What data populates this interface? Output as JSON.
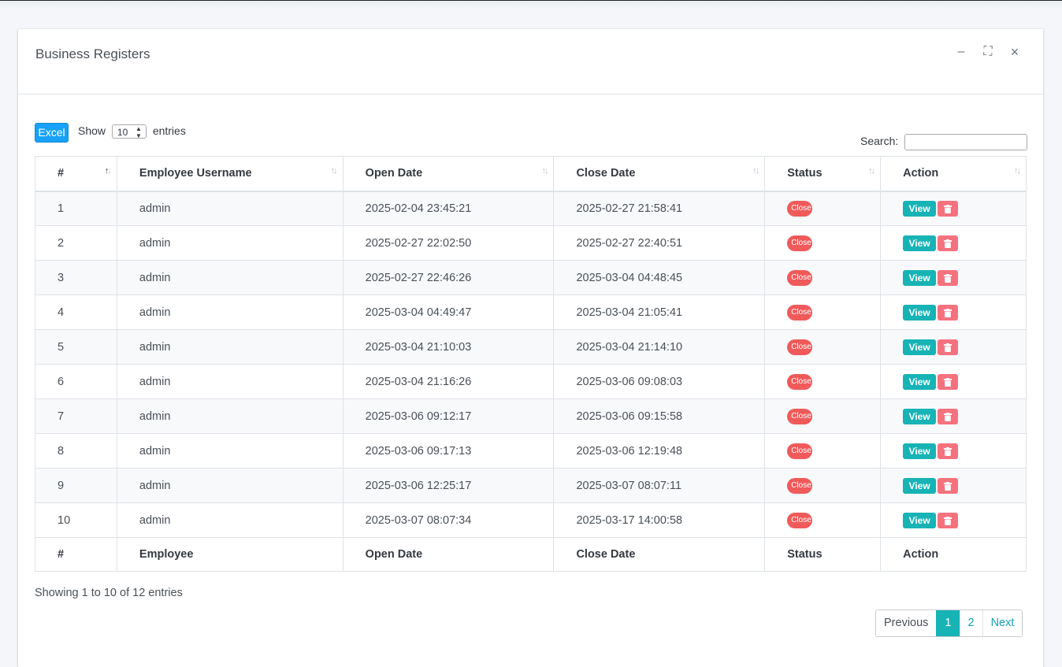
{
  "card": {
    "title": "Business Registers",
    "tools": {
      "minimize": "–",
      "maximize": "⛶",
      "close": "×"
    }
  },
  "toolbar": {
    "excel_label": "Excel",
    "show_label": "Show",
    "entries_label": "entries",
    "page_length": "10",
    "search_label": "Search:",
    "search_value": ""
  },
  "table": {
    "headers": [
      "#",
      "Employee Username",
      "Open Date",
      "Close Date",
      "Status",
      "Action"
    ],
    "footers": [
      "#",
      "Employee",
      "Open Date",
      "Close Date",
      "Status",
      "Action"
    ],
    "rows": [
      {
        "num": "1",
        "employee": "admin",
        "open": "2025-02-04 23:45:21",
        "close": "2025-02-27 21:58:41",
        "status": "Close",
        "action": "View"
      },
      {
        "num": "2",
        "employee": "admin",
        "open": "2025-02-27 22:02:50",
        "close": "2025-02-27 22:40:51",
        "status": "Close",
        "action": "View"
      },
      {
        "num": "3",
        "employee": "admin",
        "open": "2025-02-27 22:46:26",
        "close": "2025-03-04 04:48:45",
        "status": "Close",
        "action": "View"
      },
      {
        "num": "4",
        "employee": "admin",
        "open": "2025-03-04 04:49:47",
        "close": "2025-03-04 21:05:41",
        "status": "Close",
        "action": "View"
      },
      {
        "num": "5",
        "employee": "admin",
        "open": "2025-03-04 21:10:03",
        "close": "2025-03-04 21:14:10",
        "status": "Close",
        "action": "View"
      },
      {
        "num": "6",
        "employee": "admin",
        "open": "2025-03-04 21:16:26",
        "close": "2025-03-06 09:08:03",
        "status": "Close",
        "action": "View"
      },
      {
        "num": "7",
        "employee": "admin",
        "open": "2025-03-06 09:12:17",
        "close": "2025-03-06 09:15:58",
        "status": "Close",
        "action": "View"
      },
      {
        "num": "8",
        "employee": "admin",
        "open": "2025-03-06 09:17:13",
        "close": "2025-03-06 12:19:48",
        "status": "Close",
        "action": "View"
      },
      {
        "num": "9",
        "employee": "admin",
        "open": "2025-03-06 12:25:17",
        "close": "2025-03-07 08:07:11",
        "status": "Close",
        "action": "View"
      },
      {
        "num": "10",
        "employee": "admin",
        "open": "2025-03-07 08:07:34",
        "close": "2025-03-17 14:00:58",
        "status": "Close",
        "action": "View"
      }
    ]
  },
  "footer": {
    "info": "Showing 1 to 10 of 12 entries",
    "pagination": {
      "previous": "Previous",
      "pages": [
        "1",
        "2"
      ],
      "next": "Next",
      "current": "1"
    }
  },
  "colors": {
    "accent": "#17b3b5",
    "excel": "#17a2f8",
    "danger": "#f05a5a",
    "delete": "#f4727e"
  }
}
